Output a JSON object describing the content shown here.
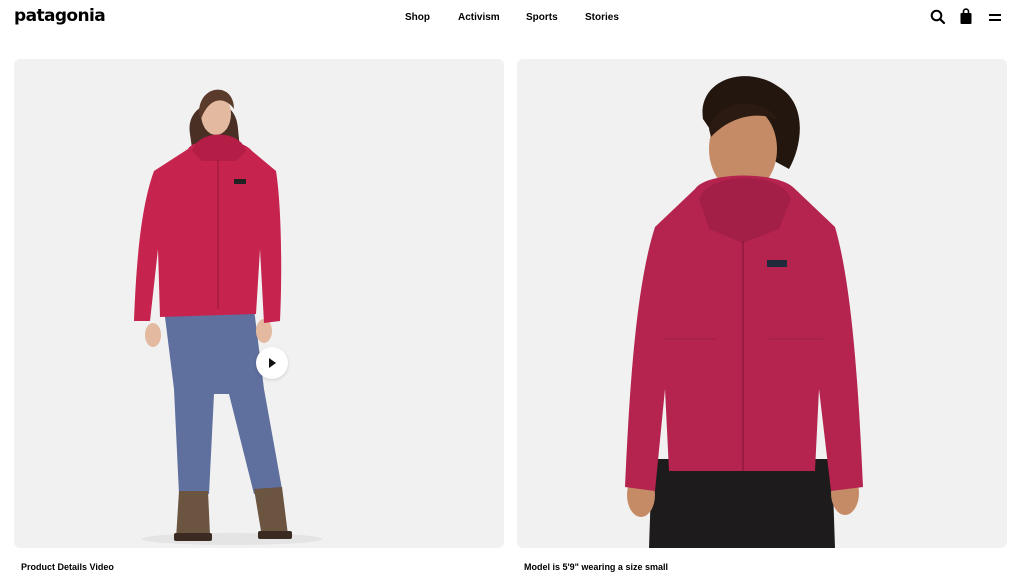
{
  "header": {
    "logo": "patagonia",
    "nav": [
      "Shop",
      "Activism",
      "Sports",
      "Stories"
    ]
  },
  "icons": [
    "search-icon",
    "bag-icon",
    "menu-icon"
  ],
  "gallery": {
    "left": {
      "caption": "Product Details Video",
      "has_video": true
    },
    "right": {
      "caption": "Model is 5'9\" wearing a size small"
    }
  },
  "colors": {
    "jacket": "#c7234f",
    "pants": "#5f6f9e",
    "card_bg": "#f1f1f1"
  }
}
